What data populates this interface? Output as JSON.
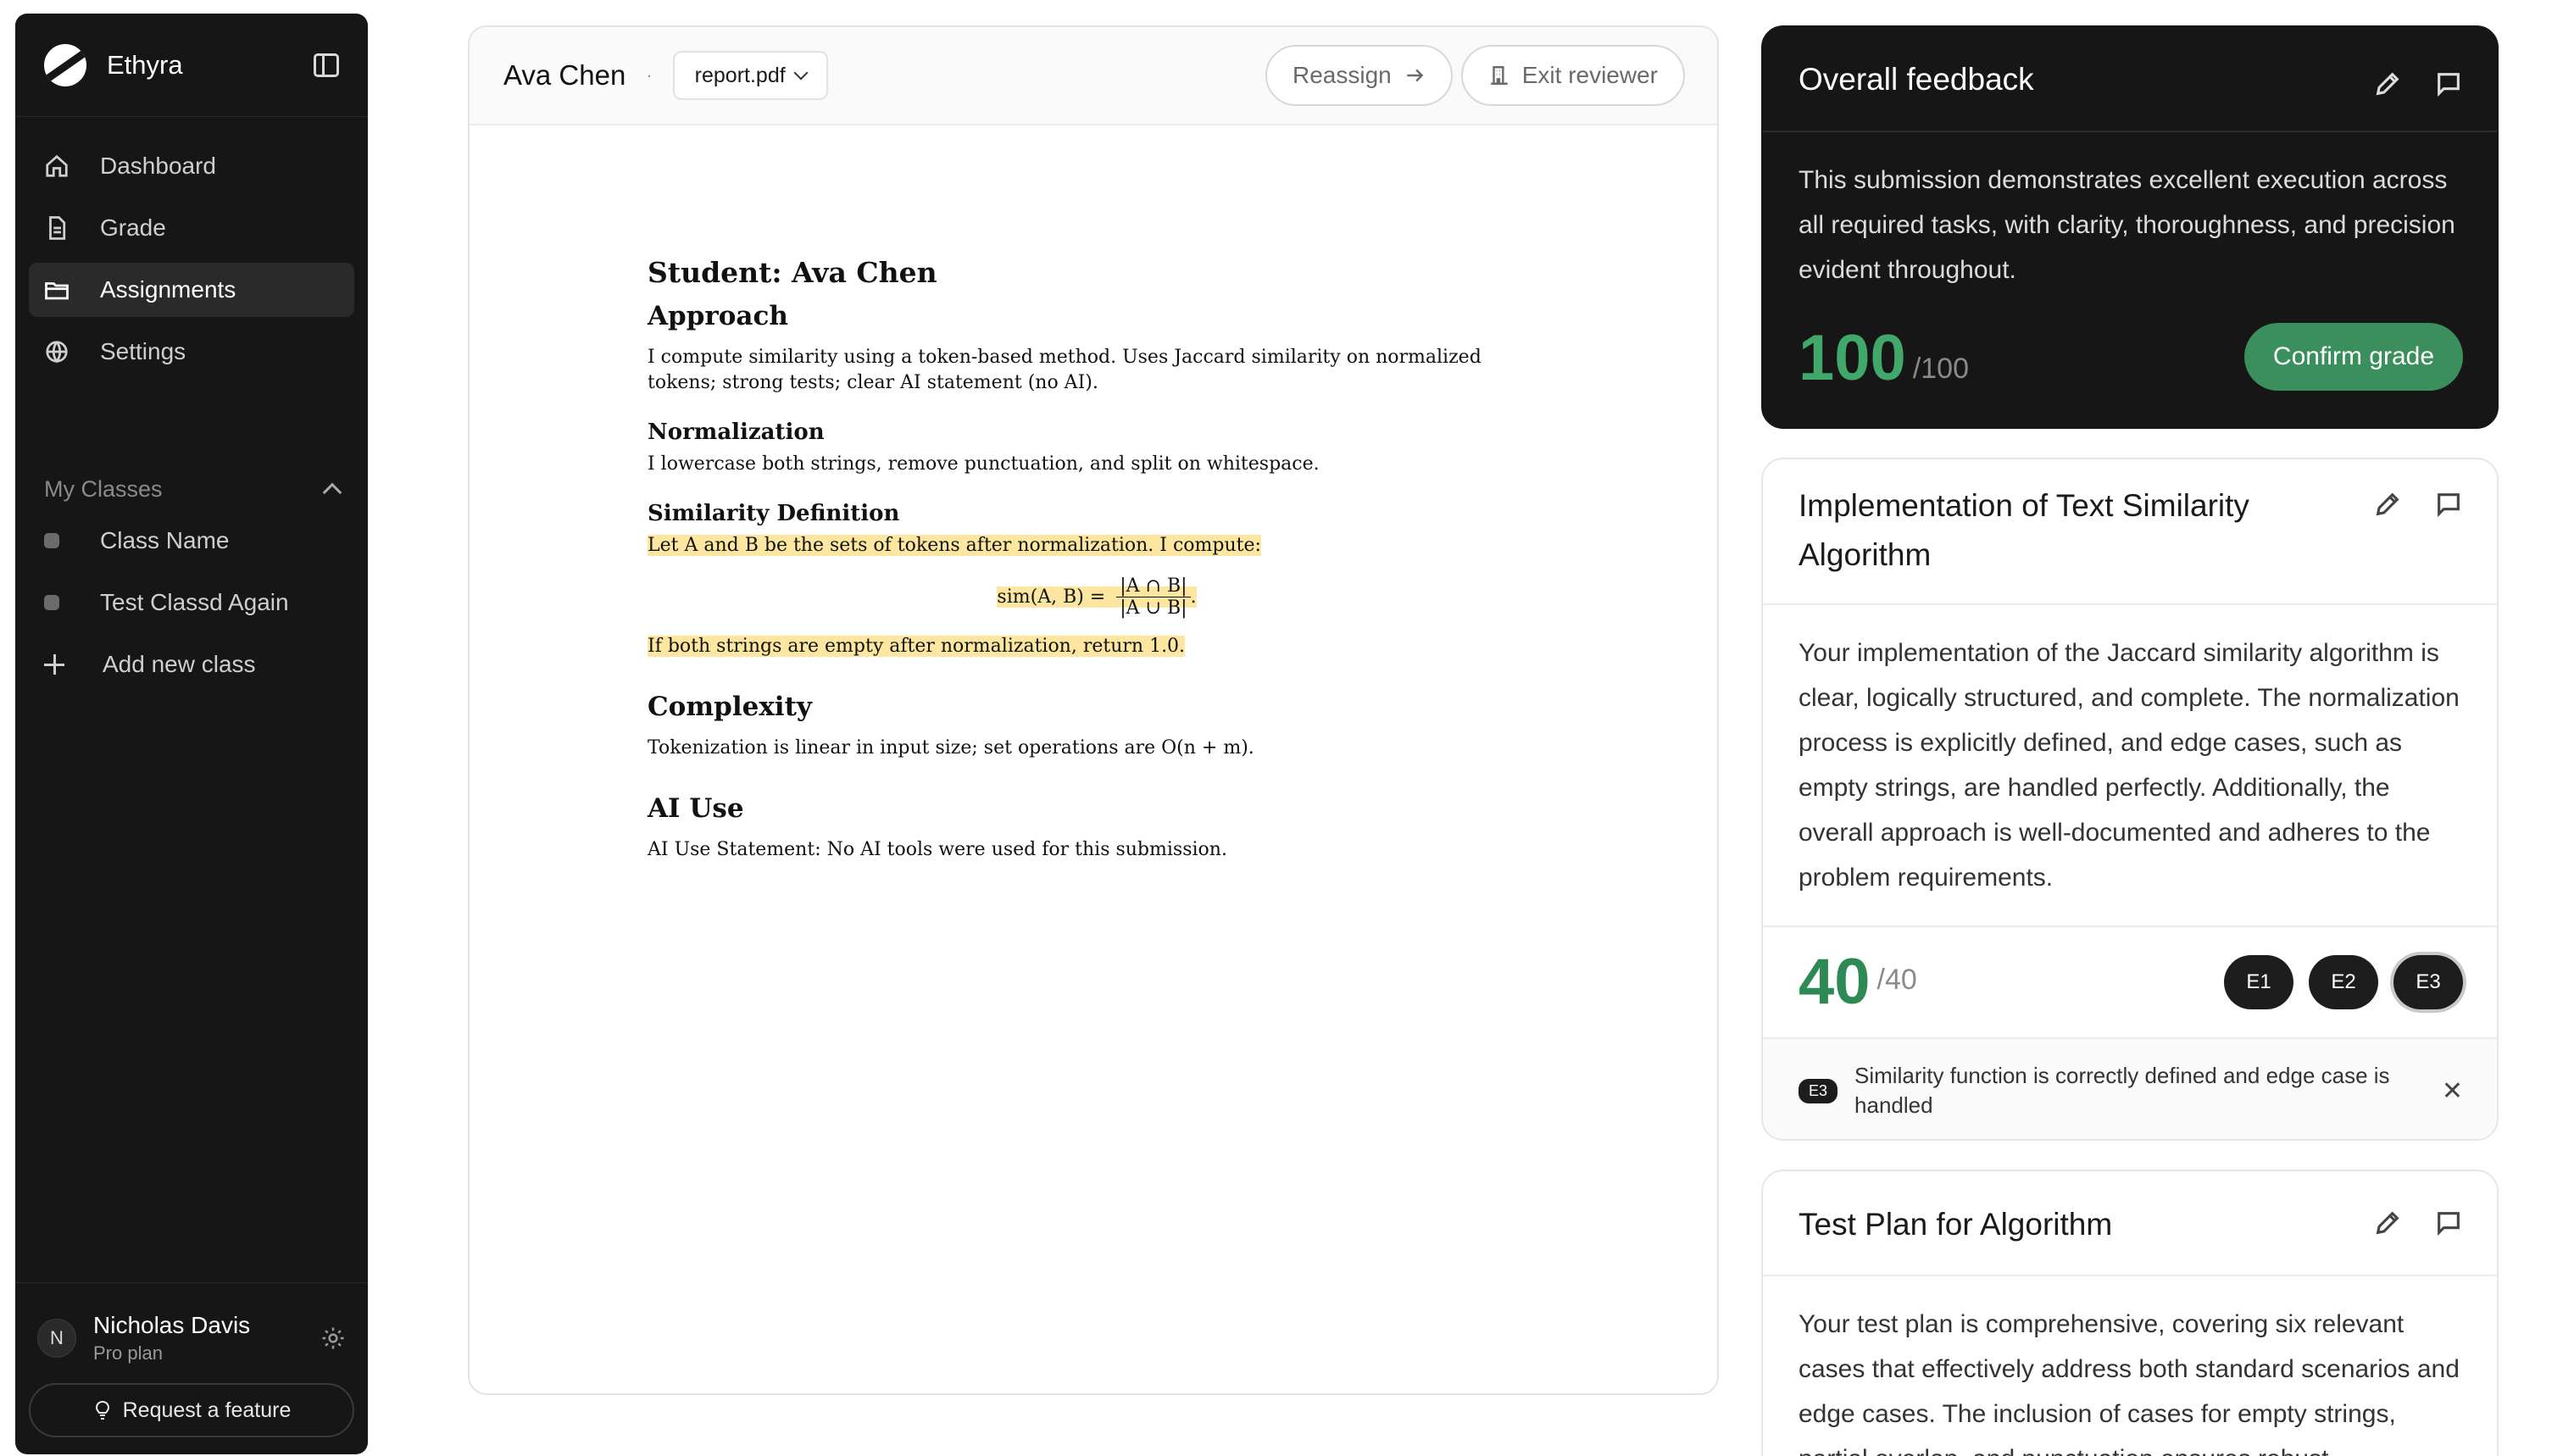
{
  "app": {
    "brand": "Ethyra"
  },
  "sidebar": {
    "nav": [
      {
        "label": "Dashboard",
        "icon": "home-icon"
      },
      {
        "label": "Grade",
        "icon": "document-icon"
      },
      {
        "label": "Assignments",
        "icon": "folder-icon",
        "active": true
      },
      {
        "label": "Settings",
        "icon": "globe-icon"
      }
    ],
    "classes_title": "My Classes",
    "classes": [
      "Class Name",
      "Test Classd Again"
    ],
    "add_class_label": "Add new class",
    "user": {
      "initial": "N",
      "name": "Nicholas Davis",
      "plan": "Pro plan"
    },
    "request_feature_label": "Request a feature"
  },
  "doc": {
    "student_name": "Ava Chen",
    "file": "report.pdf",
    "reassign_label": "Reassign",
    "exit_label": "Exit reviewer",
    "paper": {
      "title": "Student:  Ava Chen",
      "approach_h": "Approach",
      "approach_txt": "I compute similarity using a token-based method.  Uses Jaccard similarity on normalized tokens; strong tests; clear AI statement (no AI).",
      "norm_h": "Normalization",
      "norm_txt": "I lowercase both strings, remove punctuation, and split on whitespace.",
      "sim_h": "Similarity Definition",
      "sim_txt": "Let A and B be the sets of tokens after normalization.  I compute:",
      "formula_lhs": "sim(A, B) =",
      "formula_num": "|A ∩ B|",
      "formula_den": "|A ∪ B|",
      "sim_txt2": "If both strings are empty after normalization, return 1.0.",
      "complexity_h": "Complexity",
      "complexity_txt": "Tokenization is linear in input size; set operations are O(n + m).",
      "ai_h": "AI Use",
      "ai_txt": "AI Use Statement:  No AI tools were used for this submission."
    }
  },
  "feedback": {
    "overall_title": "Overall feedback",
    "overall_text": "This submission demonstrates excellent execution across all required tasks, with clarity, thoroughness, and precision evident throughout.",
    "overall_score": "100",
    "overall_max": "/100",
    "confirm_label": "Confirm grade",
    "criteria": [
      {
        "title": "Implementation of Text Similarity Algorithm",
        "text": "Your implementation of the Jaccard similarity algorithm is clear, logically structured, and complete. The normalization process is explicitly defined, and edge cases, such as empty strings, are handled perfectly. Additionally, the overall approach is well-documented and adheres to the problem requirements.",
        "score": "40",
        "max": "/40",
        "chips": [
          "E1",
          "E2",
          "E3"
        ],
        "selected_chip": "E3",
        "note_tag": "E3",
        "note_text": "Similarity function is correctly defined and edge case is handled"
      },
      {
        "title": "Test Plan for Algorithm",
        "text": "Your test plan is comprehensive, covering six relevant cases that effectively address both standard scenarios and edge cases. The inclusion of cases for empty strings, partial overlap, and punctuation ensures robust"
      }
    ]
  }
}
